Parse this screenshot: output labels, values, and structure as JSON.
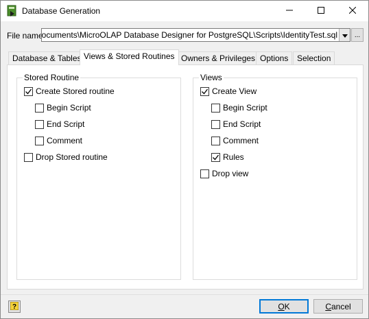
{
  "window": {
    "title": "Database Generation"
  },
  "file": {
    "label": "File name",
    "value": "el\\Documents\\MicroOLAP Database Designer for PostgreSQL\\Scripts\\IdentityTest.sql",
    "browse_label": "..."
  },
  "tabs": [
    {
      "label": "Database & Tables",
      "active": false
    },
    {
      "label": "Views & Stored Routines",
      "active": true
    },
    {
      "label": "Owners & Privileges",
      "active": false
    },
    {
      "label": "Options",
      "active": false
    },
    {
      "label": "Selection",
      "active": false
    }
  ],
  "stored_routine": {
    "title": "Stored Routine",
    "create": {
      "label": "Create Stored routine",
      "checked": true
    },
    "begin_script": {
      "label": "Begin Script",
      "checked": false
    },
    "end_script": {
      "label": "End Script",
      "checked": false
    },
    "comment": {
      "label": "Comment",
      "checked": false
    },
    "drop": {
      "label": "Drop Stored routine",
      "checked": false
    }
  },
  "views": {
    "title": "Views",
    "create": {
      "label": "Create View",
      "checked": true
    },
    "begin_script": {
      "label": "Begin Script",
      "checked": false
    },
    "end_script": {
      "label": "End Script",
      "checked": false
    },
    "comment": {
      "label": "Comment",
      "checked": false
    },
    "rules": {
      "label": "Rules",
      "checked": true
    },
    "drop": {
      "label": "Drop view",
      "checked": false
    }
  },
  "buttons": {
    "ok_key": "O",
    "ok_rest": "K",
    "cancel_key": "C",
    "cancel_rest": "ancel"
  },
  "icons": {
    "app": "database-generation-icon",
    "help": "help-question-icon",
    "minimize": "minimize-icon",
    "maximize": "maximize-icon",
    "close": "close-icon",
    "dropdown": "chevron-down-icon",
    "check": "checkmark-icon"
  }
}
